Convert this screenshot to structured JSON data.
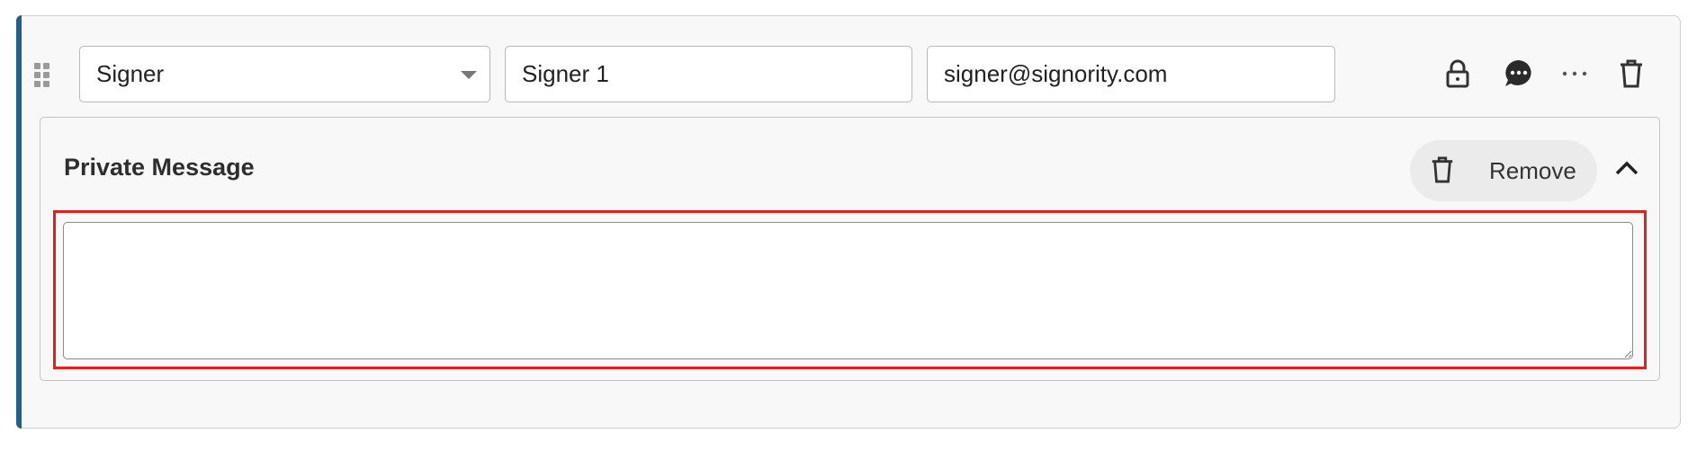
{
  "signer_row": {
    "role_select": {
      "value": "Signer",
      "icon": "chevron-down-icon"
    },
    "name_field": {
      "value": "Signer 1"
    },
    "email_field": {
      "value": "signer@signority.com"
    },
    "actions": [
      {
        "name": "lock",
        "icon": "lock-icon"
      },
      {
        "name": "private-message",
        "icon": "chat-bubble-icon"
      },
      {
        "name": "more",
        "icon": "ellipsis-icon"
      },
      {
        "name": "delete",
        "icon": "trash-icon"
      }
    ],
    "accent_color": "#1f5f8b"
  },
  "private_message": {
    "title": "Private Message",
    "remove_label": "Remove",
    "remove_icon": "trash-icon",
    "collapse_icon": "chevron-up-icon",
    "message_value": "",
    "highlight_color": "#e41f1f"
  }
}
